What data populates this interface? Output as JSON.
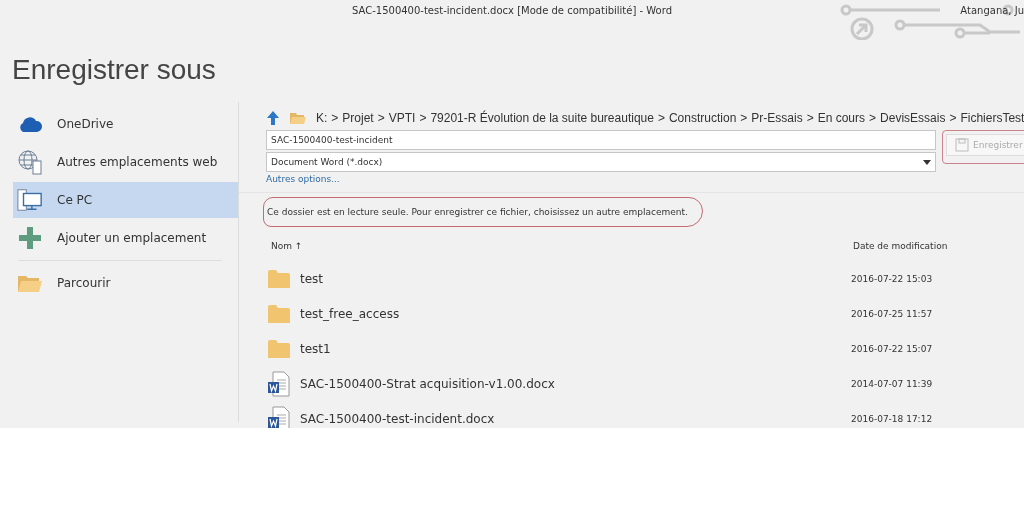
{
  "window": {
    "title": "SAC-1500400-test-incident.docx [Mode de compatibilité] - Word",
    "user": "Atangana, Ju"
  },
  "heading": "Enregistrer sous",
  "sidebar": {
    "items": [
      {
        "label": "OneDrive",
        "kind": "cloud",
        "selected": false
      },
      {
        "label": "Autres emplacements web",
        "kind": "web",
        "selected": false
      },
      {
        "label": "Ce PC",
        "kind": "pc",
        "selected": true
      },
      {
        "label": "Ajouter un emplacement",
        "kind": "add",
        "selected": false
      },
      {
        "label": "Parcourir",
        "kind": "browse",
        "selected": false
      }
    ]
  },
  "path": [
    "K:",
    "Projet",
    "VPTI",
    "79201-R Évolution de la suite bureautique",
    "Construction",
    "Pr-Essais",
    "En cours",
    "DevisEssais",
    "FichiersTest"
  ],
  "path_separator": ">",
  "filename": {
    "value": "SAC-1500400-test-incident"
  },
  "filetype": {
    "value": "Document Word (*.docx)"
  },
  "more_options": "Autres options...",
  "save_button": {
    "label": "Enregistrer",
    "disabled": true
  },
  "message": "Ce dossier est en lecture seule. Pour enregistrer ce fichier, choisissez un autre emplacement.",
  "columns": {
    "name": "Nom ↑",
    "date": "Date de modification"
  },
  "files": [
    {
      "name": "test",
      "kind": "folder",
      "date": "2016-07-22 15:03"
    },
    {
      "name": "test_free_access",
      "kind": "folder",
      "date": "2016-07-25 11:57"
    },
    {
      "name": "test1",
      "kind": "folder",
      "date": "2016-07-22 15:07"
    },
    {
      "name": "SAC-1500400-Strat acquisition-v1.00.docx",
      "kind": "docx",
      "date": "2014-07-07 11:39"
    },
    {
      "name": "SAC-1500400-test-incident.docx",
      "kind": "docx",
      "date": "2016-07-18 17:12"
    }
  ]
}
